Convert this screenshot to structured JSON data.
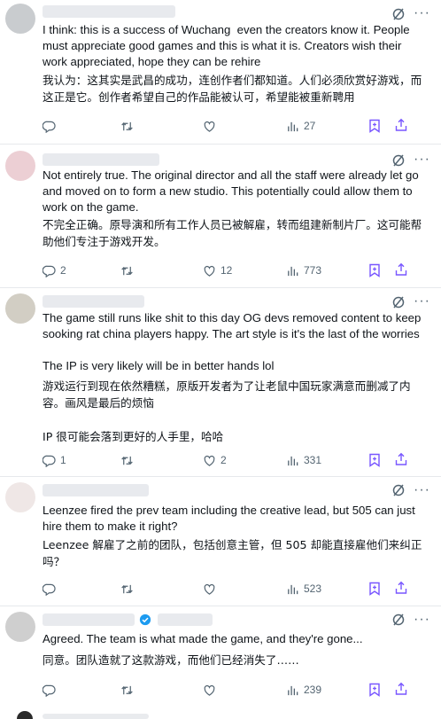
{
  "posts": [
    {
      "text": "I think: this is a success of Wuchang  even the creators know it. People must appreciate good games and this is what it is. Creators wish their work appreciated, hope they can be rehire",
      "translation": "我认为：这其实是武昌的成功，连创作者们都知道。人们必须欣赏好游戏，而这正是它。创作者希望自己的作品能被认可，希望能被重新聘用",
      "replies": "",
      "reposts": "",
      "likes": "",
      "views": "27"
    },
    {
      "text": "Not entirely true. The original director and all the staff were already let go and moved on to form a new studio. This potentially could allow them to work on the game.",
      "translation": "不完全正确。原导演和所有工作人员已被解雇，转而组建新制片厂。这可能帮助他们专注于游戏开发。",
      "replies": "2",
      "reposts": "",
      "likes": "12",
      "views": "773"
    },
    {
      "text": "The game still runs like shit to this day OG devs removed content to keep sooking rat china players happy. The art style is it's the last of the worries\n\nThe IP is very likely will be in better hands lol",
      "translation": "游戏运行到现在依然糟糕，原版开发者为了让老鼠中国玩家满意而删减了内容。画风是最后的烦恼\n\nIP 很可能会落到更好的人手里，哈哈",
      "replies": "1",
      "reposts": "",
      "likes": "2",
      "views": "331"
    },
    {
      "text": "Leenzee fired the prev team including the creative lead, but 505 can just hire them to make it right?",
      "translation": "Leenzee 解雇了之前的团队，包括创意主管，但 505 却能直接雇他们来纠正吗？",
      "replies": "",
      "reposts": "",
      "likes": "",
      "views": "523"
    },
    {
      "text": "Agreed. The team is what made the game, and they're gone...",
      "translation": "同意。团队造就了这款游戏，而他们已经消失了……",
      "replies": "",
      "reposts": "",
      "likes": "",
      "views": "239"
    }
  ],
  "colors": {
    "text": "#0f1419",
    "muted": "#536471",
    "action_purple": "#7856ff",
    "divider": "#e6e9ec",
    "verified": "#1d9bf0"
  },
  "icons": [
    "grok-icon",
    "more-icon",
    "reply-icon",
    "repost-icon",
    "like-icon",
    "views-icon",
    "bookmark-icon",
    "share-icon",
    "verified-badge-icon"
  ]
}
